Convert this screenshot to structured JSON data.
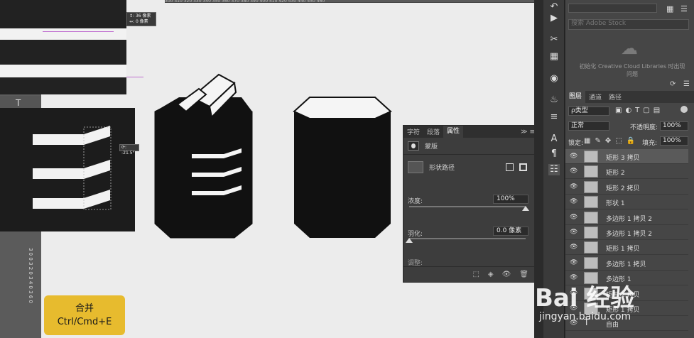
{
  "top_ruler_marks": "300   310   320   330   340   350   360   370   380   390   400   410   420   430   440   450   460",
  "left_tools": {
    "type_tool": "T"
  },
  "tooltip_move": {
    "line1": "↕: 36 像素",
    "line2": "↔: 0 像素"
  },
  "tooltip_rotate": "⟳: -21.5°",
  "left_ruler": "3 0 0 3 2 0 3 4 0 3 6 0",
  "merge_badge": {
    "line1": "合并",
    "line2": "Ctrl/Cmd+E"
  },
  "properties_panel": {
    "tabs": [
      "字符",
      "段落",
      "属性"
    ],
    "menu_label": "≫ ≡",
    "mask_label": "蒙版",
    "vector_label": "形状路径",
    "density_label": "浓度:",
    "density_value": "100%",
    "density_level": 1.0,
    "feather_label": "羽化:",
    "feather_value": "0.0 像素",
    "feather_level": 0.0,
    "adjust_label": "调整:"
  },
  "libraries": {
    "search_placeholder": "搜索 Adobe Stock",
    "message_line1": "初始化 Creative Cloud Libraries 时出现",
    "message_line2": "问题"
  },
  "layers_panel": {
    "tabs": [
      "图层",
      "通道",
      "路径"
    ],
    "filter_label": "ρ类型",
    "blend_mode": "正常",
    "opacity_label": "不透明度:",
    "opacity_value": "100%",
    "lock_label": "锁定:",
    "fill_label": "填充:",
    "fill_value": "100%",
    "layers": [
      {
        "name": "矩形 3 拷贝",
        "type": "shape"
      },
      {
        "name": "矩形 2",
        "type": "shape"
      },
      {
        "name": "矩形 2 拷贝",
        "type": "shape"
      },
      {
        "name": "形状 1",
        "type": "shape"
      },
      {
        "name": "多边形 1 拷贝 2",
        "type": "shape"
      },
      {
        "name": "多边形 1 拷贝 2",
        "type": "shape"
      },
      {
        "name": "矩形 1 拷贝",
        "type": "shape"
      },
      {
        "name": "多边形 1 拷贝",
        "type": "shape"
      },
      {
        "name": "多边形 1",
        "type": "shape"
      },
      {
        "name": "矩形 1 拷贝",
        "type": "shape"
      },
      {
        "name": "矩形 1 拷贝",
        "type": "shape"
      },
      {
        "name": "自由",
        "type": "text"
      }
    ]
  },
  "watermark": {
    "brand": "Bai 经验",
    "url": "jingyan.baidu.com"
  },
  "colors": {
    "canvas": "#ececec",
    "shape_fill": "#111111",
    "badge": "#e7bb2e",
    "panel": "#464646"
  }
}
